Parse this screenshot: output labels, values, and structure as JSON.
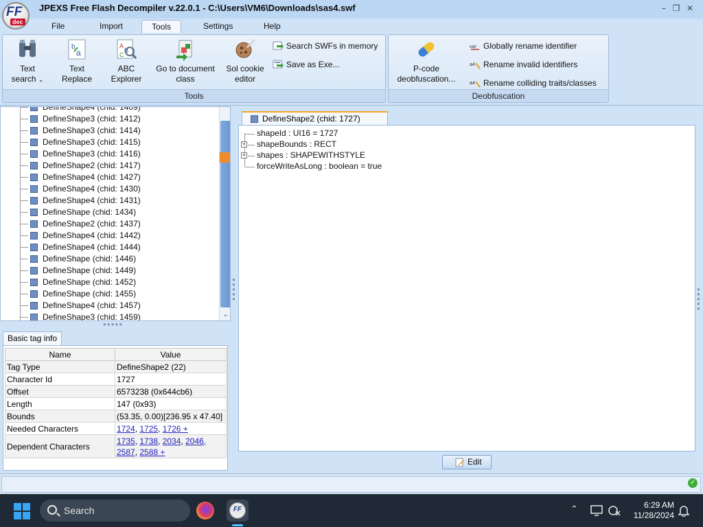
{
  "window": {
    "title": "JPEXS Free Flash Decompiler v.22.0.1 - C:\\Users\\VM6\\Downloads\\sas4.swf",
    "logo_text": "FF",
    "logo_sub": "dec"
  },
  "menu": {
    "tabs": [
      "File",
      "Import",
      "Tools",
      "Settings",
      "Help"
    ],
    "active": "Tools"
  },
  "ribbon": {
    "tools_group": {
      "label": "Tools",
      "text_search_line1": "Text",
      "text_search_line2": "search",
      "text_replace_line1": "Text",
      "text_replace_line2": "Replace",
      "abc_line1": "ABC",
      "abc_line2": "Explorer",
      "goto_line1": "Go to document",
      "goto_line2": "class",
      "sol_line1": "Sol cookie",
      "sol_line2": "editor",
      "search_swfs": "Search SWFs in memory",
      "save_exe": "Save as Exe..."
    },
    "deobf_group": {
      "label": "Deobfuscation",
      "pcode_line1": "P-code",
      "pcode_line2": "deobfuscation...",
      "global_rename": "Globally rename identifier",
      "rename_invalid": "Rename invalid identifiers",
      "rename_colliding": "Rename colliding traits/classes"
    }
  },
  "tree": {
    "items": [
      "DefineShape4 (chid: 1409)",
      "DefineShape3 (chid: 1412)",
      "DefineShape3 (chid: 1414)",
      "DefineShape3 (chid: 1415)",
      "DefineShape3 (chid: 1416)",
      "DefineShape2 (chid: 1417)",
      "DefineShape4 (chid: 1427)",
      "DefineShape4 (chid: 1430)",
      "DefineShape4 (chid: 1431)",
      "DefineShape (chid: 1434)",
      "DefineShape2 (chid: 1437)",
      "DefineShape4 (chid: 1442)",
      "DefineShape4 (chid: 1444)",
      "DefineShape (chid: 1446)",
      "DefineShape (chid: 1449)",
      "DefineShape (chid: 1452)",
      "DefineShape (chid: 1455)",
      "DefineShape4 (chid: 1457)",
      "DefineShape3 (chid: 1459)"
    ]
  },
  "basic_info": {
    "tab": "Basic tag info",
    "col_name": "Name",
    "col_value": "Value",
    "rows": {
      "tag_type": {
        "name": "Tag Type",
        "value": "DefineShape2 (22)"
      },
      "character_id": {
        "name": "Character Id",
        "value": "1727"
      },
      "offset": {
        "name": "Offset",
        "value": "6573238 (0x644cb6)"
      },
      "length": {
        "name": "Length",
        "value": "147 (0x93)"
      },
      "bounds": {
        "name": "Bounds",
        "value": "(53.35, 0.00)[236.95 x 47.40]"
      },
      "needed": {
        "name": "Needed Characters",
        "links": [
          "1724",
          "1725",
          "1726 +"
        ]
      },
      "dependent": {
        "name": "Dependent Characters",
        "links_line1": [
          "1735",
          "1738",
          "2034",
          "2046,"
        ],
        "links_line2": [
          "2587",
          "2588 +"
        ]
      }
    }
  },
  "document": {
    "tab": "DefineShape2 (chid: 1727)",
    "props": [
      "shapeId : UI16 = 1727",
      "shapeBounds : RECT",
      "shapes : SHAPEWITHSTYLE",
      "forceWriteAsLong : boolean = true"
    ],
    "edit_label": "Edit"
  },
  "taskbar": {
    "search_placeholder": "Search",
    "time": "6:29 AM",
    "date": "11/28/2024"
  },
  "colors": {
    "accent": "#6a98d2",
    "selected_mark": "#f08c2a",
    "tab_highlight": "#f5a623"
  }
}
